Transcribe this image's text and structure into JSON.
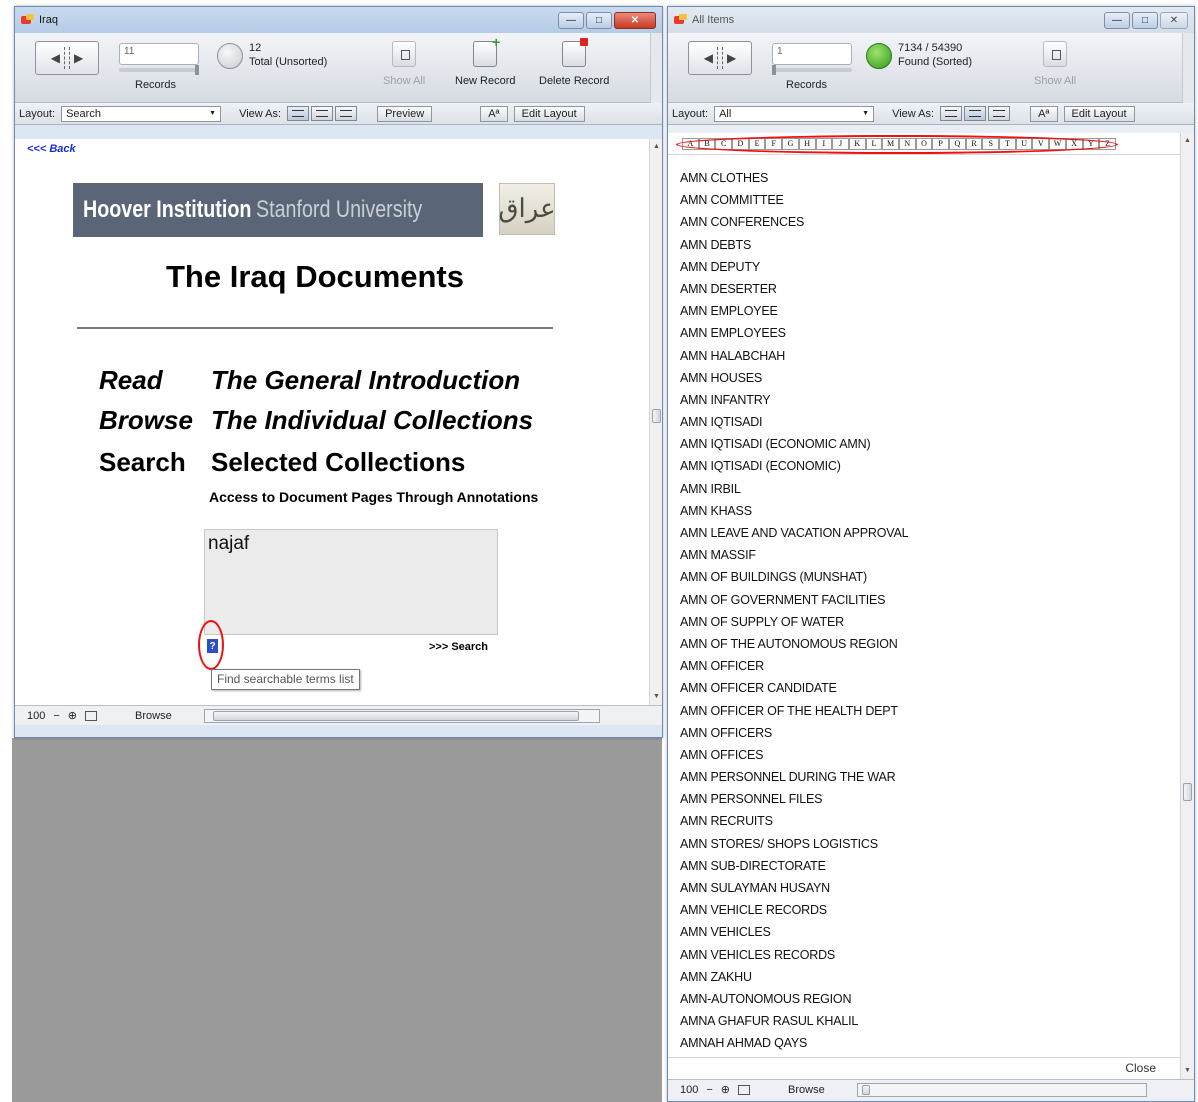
{
  "left_window": {
    "title": "Iraq",
    "records": {
      "current": "11",
      "count": "12",
      "status": "Total (Unsorted)",
      "label": "Records"
    },
    "toolbar": {
      "show_all": "Show All",
      "new_record": "New Record",
      "delete_record": "Delete Record"
    },
    "layout_bar": {
      "layout_label": "Layout:",
      "layout_value": "Search",
      "view_as_label": "View As:",
      "preview": "Preview",
      "aa": "Aª",
      "edit_layout": "Edit Layout"
    },
    "content": {
      "back_link": "<<< Back",
      "banner_bold": "Hoover Institution",
      "banner_light": "Stanford University",
      "logo_glyph": "عراق",
      "title": "The Iraq Documents",
      "nav": [
        {
          "verb": "Read",
          "target": "The General Introduction"
        },
        {
          "verb": "Browse",
          "target": "The Individual Collections"
        },
        {
          "verb": "Search",
          "target": "Selected Collections"
        }
      ],
      "access_note": "Access to Document Pages Through Annotations",
      "search_value": "najaf",
      "help_button": "?",
      "search_link": ">>> Search",
      "tooltip": "Find searchable terms list"
    },
    "status": {
      "zoom": "100",
      "mode": "Browse"
    }
  },
  "right_window": {
    "title": "All Items",
    "records": {
      "current": "1",
      "count": "7134 / 54390",
      "status": "Found (Sorted)",
      "label": "Records"
    },
    "toolbar": {
      "show_all": "Show All"
    },
    "layout_bar": {
      "layout_label": "Layout:",
      "layout_value": "All",
      "view_as_label": "View As:",
      "aa": "Aª",
      "edit_layout": "Edit Layout"
    },
    "alphabet": [
      "A",
      "B",
      "C",
      "D",
      "E",
      "F",
      "G",
      "H",
      "I",
      "J",
      "K",
      "L",
      "M",
      "N",
      "O",
      "P",
      "Q",
      "R",
      "S",
      "T",
      "U",
      "V",
      "W",
      "X",
      "Y",
      "Z"
    ],
    "terms": [
      "AMN CLOTHES",
      "AMN COMMITTEE",
      "AMN CONFERENCES",
      "AMN DEBTS",
      "AMN DEPUTY",
      "AMN DESERTER",
      "AMN EMPLOYEE",
      "AMN EMPLOYEES",
      "AMN HALABCHAH",
      "AMN HOUSES",
      "AMN INFANTRY",
      "AMN IQTISADI",
      "AMN IQTISADI (ECONOMIC AMN)",
      "AMN IQTISADI (ECONOMIC)",
      "AMN IRBIL",
      "AMN KHASS",
      "AMN LEAVE AND VACATION APPROVAL",
      "AMN MASSIF",
      "AMN OF BUILDINGS (MUNSHAT)",
      "AMN OF GOVERNMENT FACILITIES",
      "AMN OF SUPPLY OF WATER",
      "AMN OF THE AUTONOMOUS REGION",
      "AMN OFFICER",
      "AMN OFFICER CANDIDATE",
      "AMN OFFICER OF THE HEALTH DEPT",
      "AMN OFFICERS",
      "AMN OFFICES",
      "AMN PERSONNEL DURING THE WAR",
      "AMN PERSONNEL FILES",
      "AMN RECRUITS",
      "AMN STORES/ SHOPS LOGISTICS",
      "AMN SUB-DIRECTORATE",
      "AMN SULAYMAN HUSAYN",
      "AMN VEHICLE RECORDS",
      "AMN VEHICLES",
      "AMN VEHICLES RECORDS",
      "AMN ZAKHU",
      "AMN-AUTONOMOUS REGION",
      "AMNA GHAFUR RASUL KHALIL",
      "AMNAH AHMAD QAYS"
    ],
    "close": "Close",
    "status": {
      "zoom": "100",
      "mode": "Browse"
    }
  }
}
